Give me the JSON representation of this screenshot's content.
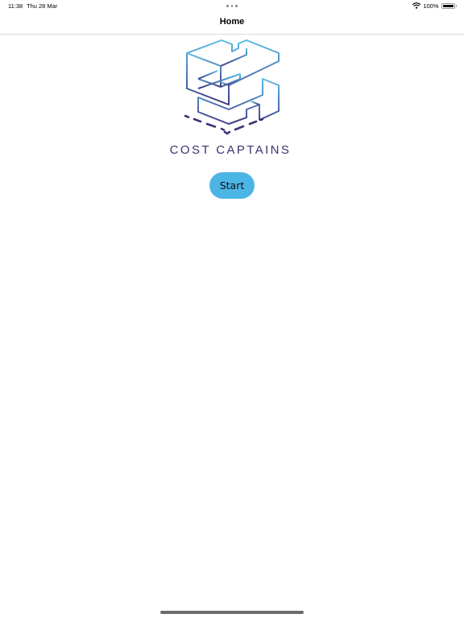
{
  "status_bar": {
    "time": "11:38",
    "date": "Thu 28 Mar",
    "battery_text": "100%",
    "battery_level": 1.0,
    "wifi_icon": "wifi-icon",
    "battery_icon": "battery-icon"
  },
  "nav": {
    "title": "Home"
  },
  "brand": {
    "name": "COST CAPTAINS",
    "logo_icon": "cost-captains-logo",
    "logo_gradient": [
      "#5bbde4",
      "#423b86"
    ]
  },
  "actions": {
    "start_label": "Start",
    "start_color": "#4cb5e6"
  }
}
